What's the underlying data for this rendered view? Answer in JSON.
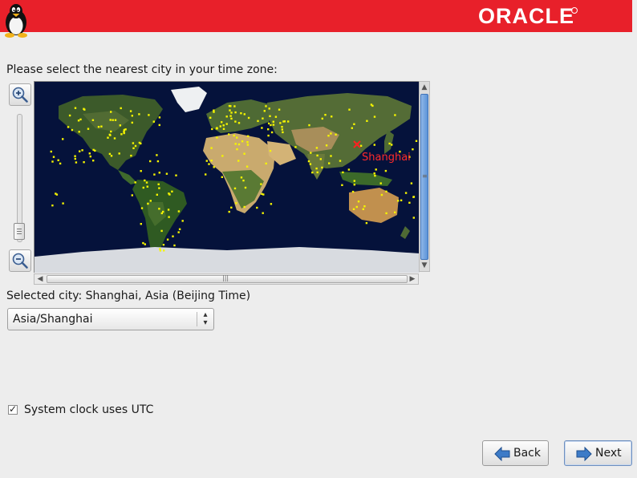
{
  "header": {
    "brand_logo_text": "ORACLE",
    "brand_color": "#e8202a",
    "logo_icon": "tux-penguin-icon"
  },
  "timezone": {
    "prompt": "Please select the nearest city in your time zone:",
    "map": {
      "highlighted_city_label": "Shanghai",
      "marker_color": "#ff2020",
      "city_dot_color": "#f5f500",
      "ocean_color": "#05123b"
    },
    "zoom_in_icon": "zoom-in-icon",
    "zoom_out_icon": "zoom-out-icon",
    "selected_city_text": "Selected city: Shanghai, Asia (Beijing Time)",
    "timezone_select_value": "Asia/Shanghai"
  },
  "utc": {
    "checked": true,
    "label": "System clock uses UTC"
  },
  "navigation": {
    "back_label": "Back",
    "next_label": "Next",
    "back_icon": "arrow-left-icon",
    "next_icon": "arrow-right-icon"
  }
}
